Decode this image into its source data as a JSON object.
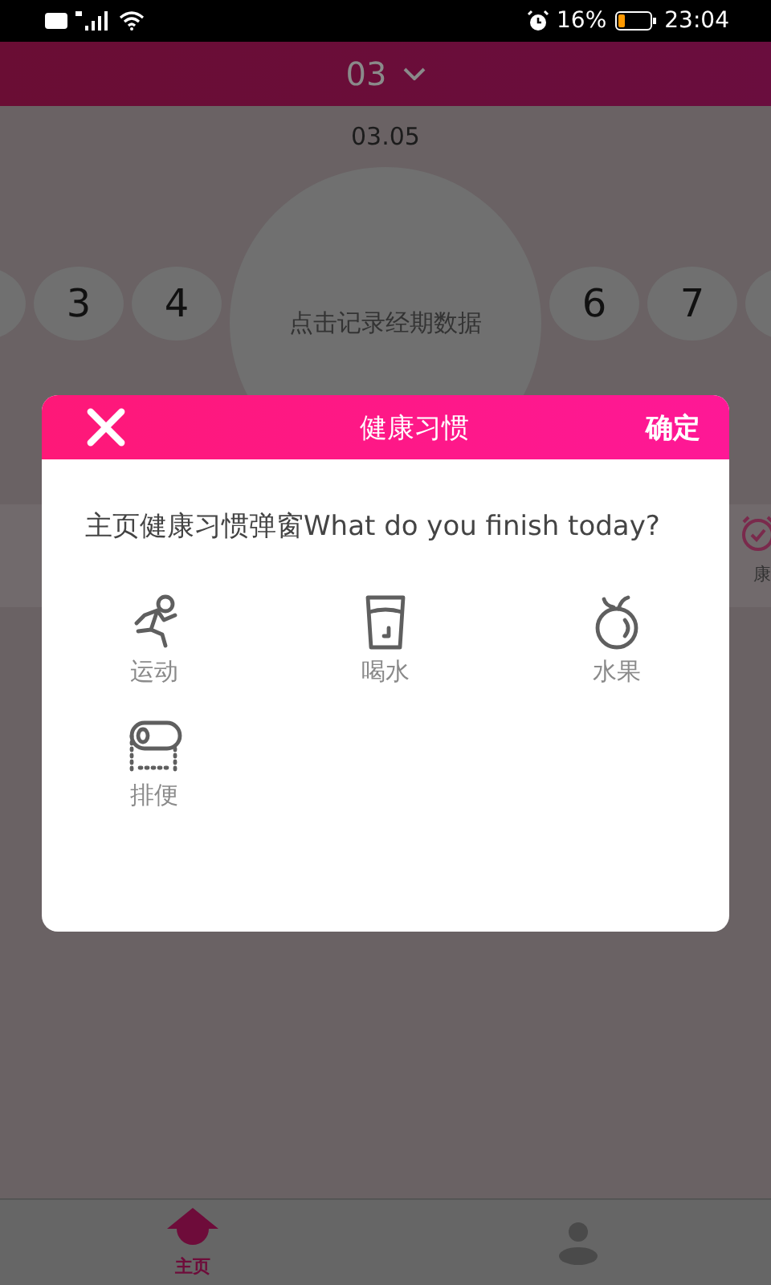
{
  "status_bar": {
    "battery_percent": "16%",
    "time": "23:04"
  },
  "header": {
    "month": "03"
  },
  "date": "03.05",
  "days": [
    {
      "kind": "small",
      "label": "3"
    },
    {
      "kind": "small",
      "label": "4"
    },
    {
      "kind": "big",
      "label": "点击记录经期数据"
    },
    {
      "kind": "small",
      "label": "6"
    },
    {
      "kind": "small",
      "label": "7"
    }
  ],
  "side_shortcut": {
    "label": "康"
  },
  "dialog": {
    "title": "健康习惯",
    "confirm": "确定",
    "prompt": "主页健康习惯弹窗What do you finish today?",
    "habits": [
      {
        "kind": "run",
        "label": "运动"
      },
      {
        "kind": "water",
        "label": "喝水"
      },
      {
        "kind": "fruit",
        "label": "水果"
      },
      {
        "kind": "toilet",
        "label": "排便"
      }
    ]
  },
  "tabs": [
    {
      "kind": "home",
      "label": "主页",
      "selected": true
    },
    {
      "kind": "profile",
      "selected": false
    }
  ]
}
